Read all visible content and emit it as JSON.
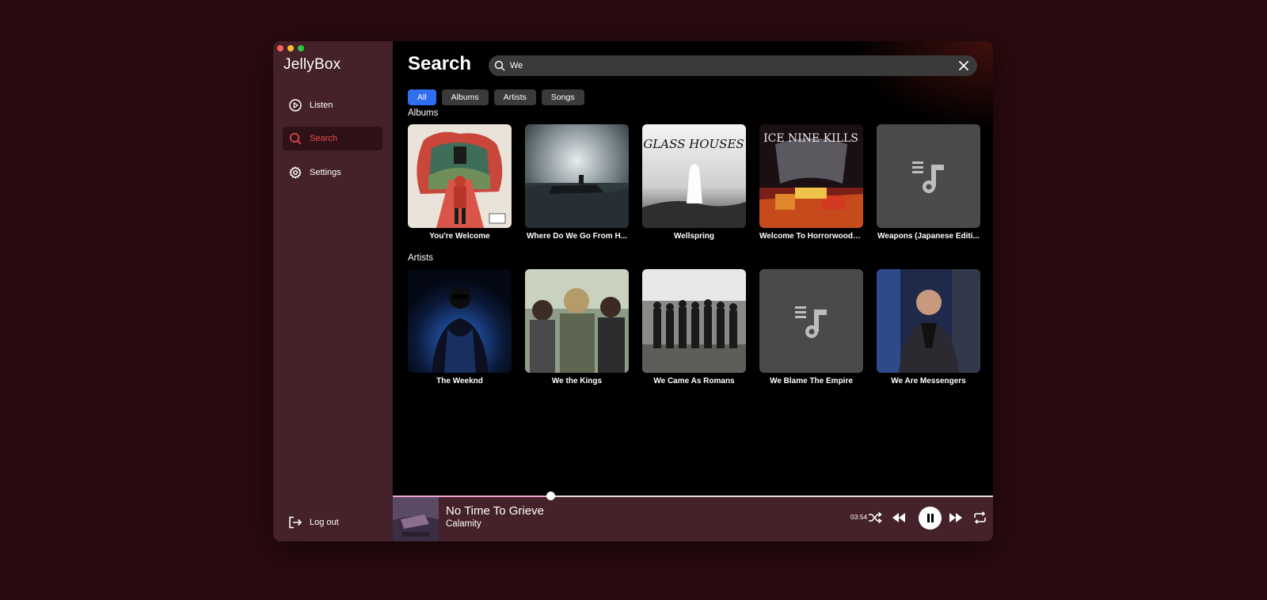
{
  "app": {
    "title": "JellyBox"
  },
  "sidebar": {
    "items": [
      {
        "label": "Listen",
        "icon": "play-circle-icon"
      },
      {
        "label": "Search",
        "icon": "search-icon",
        "active": true
      },
      {
        "label": "Settings",
        "icon": "gear-icon"
      }
    ],
    "logout_label": "Log out"
  },
  "main": {
    "title": "Search",
    "search": {
      "value": "We"
    },
    "filters": [
      "All",
      "Albums",
      "Artists",
      "Songs"
    ],
    "active_filter": "All",
    "albums_label": "Albums",
    "artists_label": "Artists",
    "albums": [
      {
        "title": "You're Welcome"
      },
      {
        "title": "Where Do We Go From H..."
      },
      {
        "title": "Wellspring",
        "cover_text": "GLASS HOUSES"
      },
      {
        "title": "Welcome To Horrorwood: ...",
        "cover_text": "ICE NINE KILLS"
      },
      {
        "title": "Weapons (Japanese Editi...",
        "placeholder": true
      }
    ],
    "artists": [
      {
        "name": "The Weeknd"
      },
      {
        "name": "We the Kings"
      },
      {
        "name": "We Came As Romans"
      },
      {
        "name": "We Blame The Empire",
        "placeholder": true
      },
      {
        "name": "We Are Messengers"
      }
    ]
  },
  "player": {
    "title": "No Time To Grieve",
    "artist": "Calamity",
    "time": "03:54",
    "progress": 0.263,
    "state": "playing"
  },
  "colors": {
    "accent": "#2f6ef0",
    "active_nav": "#e84a4a",
    "sidebar_bg": "#45212a"
  }
}
